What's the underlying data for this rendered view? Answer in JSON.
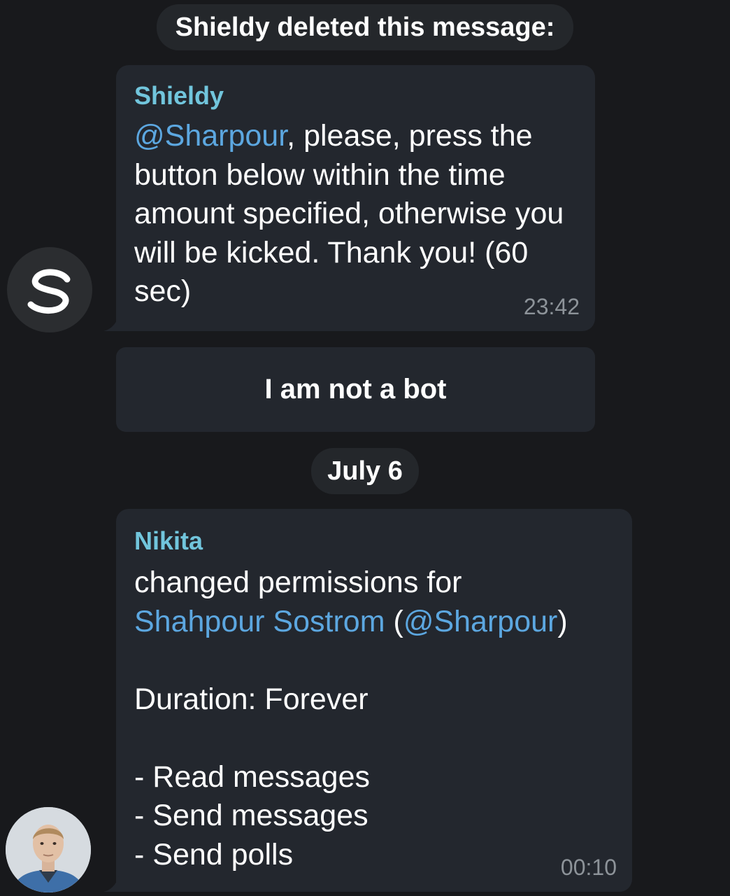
{
  "service_message": {
    "text": "Shieldy deleted this message:"
  },
  "messages": [
    {
      "sender": "Shieldy",
      "mention": "@Sharpour",
      "text": ", please, press the button below within the time amount specified, otherwise you will be kicked. Thank you! (60 sec)",
      "time": "23:42",
      "avatar_letter": "S"
    },
    {
      "sender": "Nikita",
      "line_prefix": "changed permissions for",
      "user_link": "Shahpour Sostrom",
      "open_paren": " (",
      "mention": "@Sharpour",
      "close_paren": ")",
      "duration": "Duration: Forever",
      "permissions": [
        "- Read messages",
        "- Send messages",
        "- Send polls"
      ],
      "time": "00:10"
    }
  ],
  "inline_button": {
    "label": "I am not a bot"
  },
  "date_separator": {
    "label": "July 6"
  },
  "colors": {
    "background": "#18191c",
    "bubble": "#23272e",
    "sender_name": "#71c5dc",
    "link": "#5ca7e0",
    "timestamp": "#8d9399"
  }
}
